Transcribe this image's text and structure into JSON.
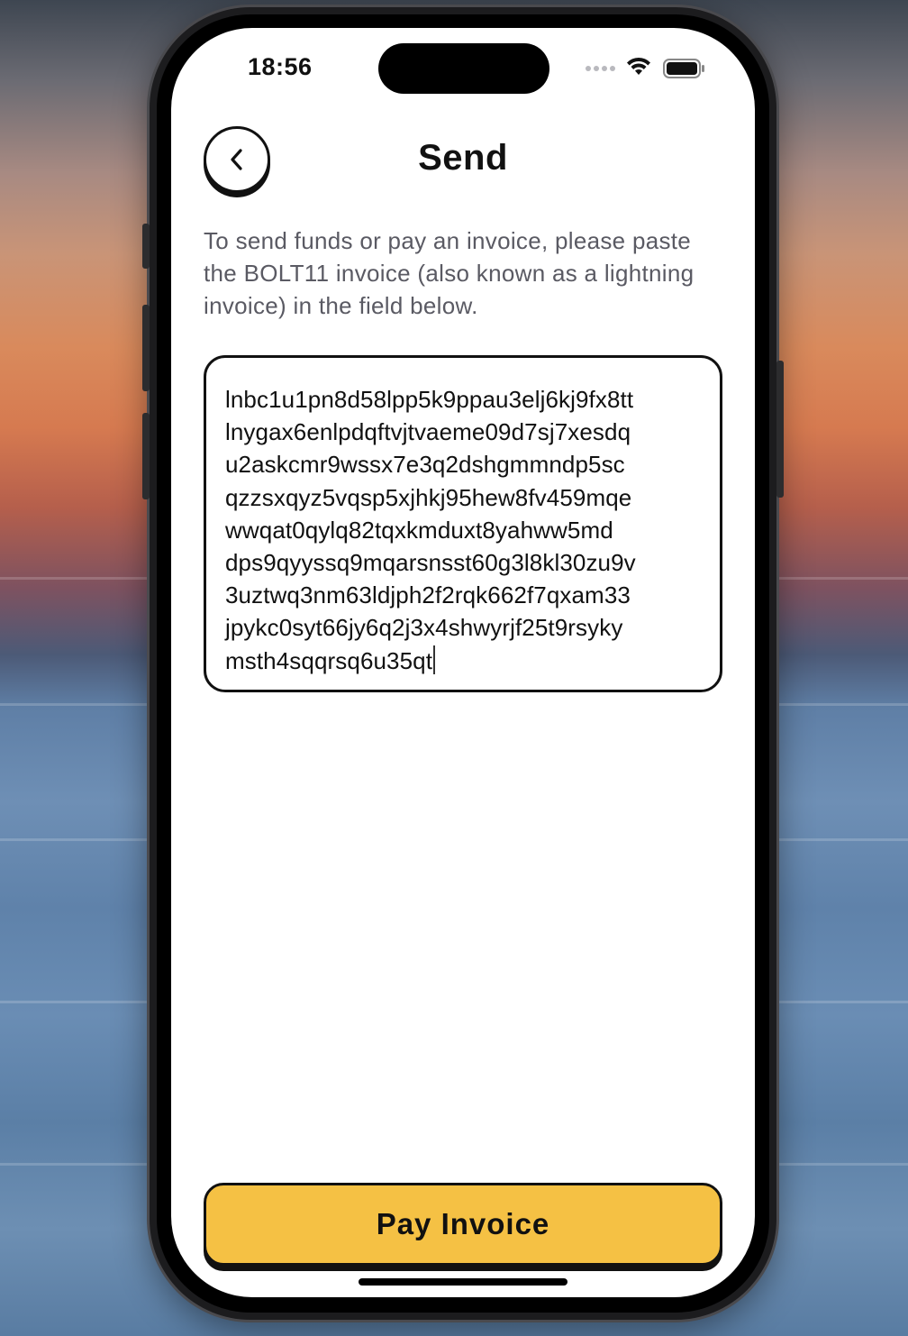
{
  "status_bar": {
    "time": "18:56"
  },
  "header": {
    "back_icon": "chevron-left-icon",
    "title": "Send"
  },
  "instructions": {
    "text": "To send funds or pay an invoice, please paste the BOLT11 invoice (also known as a lightning invoice) in the field below."
  },
  "invoice_field": {
    "lines": [
      "lnbc1u1pn8d58lpp5k9ppau3elj6kj9fx8tt",
      "lnygax6enlpdqftvjtvaeme09d7sj7xesdq",
      "u2askcmr9wssx7e3q2dshgmmndp5sc",
      "qzzsxqyz5vqsp5xjhkj95hew8fv459mqe",
      "wwqat0qylq82tqxkmduxt8yahww5md",
      "dps9qyyssq9mqarsnsst60g3l8kl30zu9v",
      "3uztwq3nm63ldjph2f2rqk662f7qxam33",
      "jpykc0syt66jy6q2j3x4shwyrjf25t9rsyky",
      "msth4sqqrsq6u35qt"
    ]
  },
  "actions": {
    "pay_label": "Pay Invoice"
  },
  "colors": {
    "accent": "#f5c144",
    "text": "#111111",
    "muted_text": "#5a5a63",
    "screen_background": "#ffffff"
  }
}
